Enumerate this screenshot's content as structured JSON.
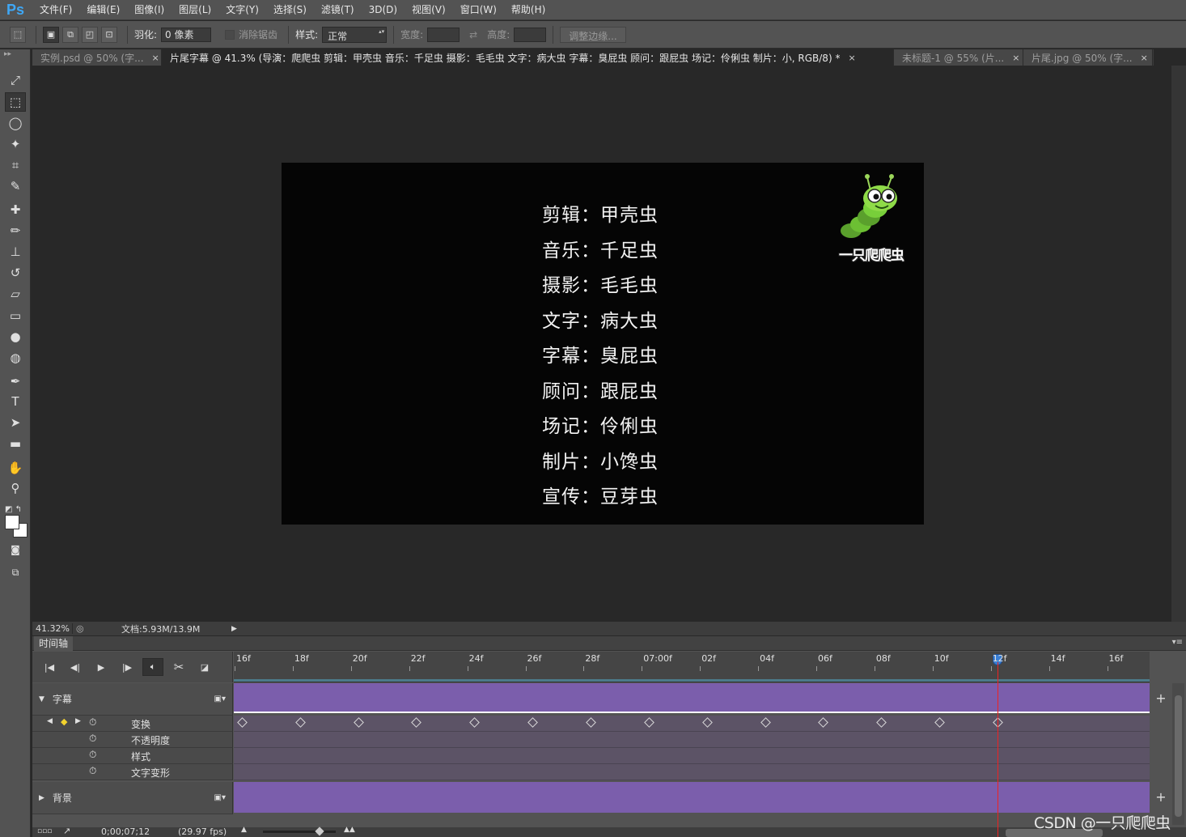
{
  "app": {
    "logo": "Ps"
  },
  "menu": [
    "文件(F)",
    "编辑(E)",
    "图像(I)",
    "图层(L)",
    "文字(Y)",
    "选择(S)",
    "滤镜(T)",
    "3D(D)",
    "视图(V)",
    "窗口(W)",
    "帮助(H)"
  ],
  "options": {
    "feather_label": "羽化:",
    "feather_value": "0 像素",
    "antialias_label": "消除锯齿",
    "style_label": "样式:",
    "style_value": "正常",
    "width_label": "宽度:",
    "height_label": "高度:",
    "refine_edge": "调整边缘..."
  },
  "tabs": [
    {
      "label": "实例.psd @ 50% (字...",
      "active": false
    },
    {
      "label": "片尾字幕 @ 41.3% (导演：爬爬虫   剪辑：甲壳虫 音乐：千足虫 摄影：毛毛虫 文字：病大虫 字幕：臭屁虫 顾问：跟屁虫 场记：伶俐虫 制片：小, RGB/8) *",
      "active": true
    },
    {
      "label": "未标题-1 @ 55% (片...",
      "active": false
    },
    {
      "label": "片尾.jpg @ 50% (字...",
      "active": false
    }
  ],
  "tools": [
    "move-icon",
    "marquee-icon",
    "lasso-icon",
    "magic-wand-icon",
    "crop-icon",
    "eyedropper-icon",
    "healing-brush-icon",
    "brush-icon",
    "stamp-icon",
    "history-brush-icon",
    "eraser-icon",
    "gradient-icon",
    "blur-icon",
    "dodge-icon",
    "pen-icon",
    "type-icon",
    "path-select-icon",
    "shape-icon",
    "hand-icon",
    "zoom-icon"
  ],
  "canvas": {
    "credits": [
      "剪辑：甲壳虫",
      "音乐：千足虫",
      "摄影：毛毛虫",
      "文字：病大虫",
      "字幕：臭屁虫",
      "顾问：跟屁虫",
      "场记：伶俐虫",
      "制片：小馋虫",
      "宣传：豆芽虫"
    ],
    "logo_text": "一只爬爬虫"
  },
  "status": {
    "zoom": "41.32%",
    "doc": "文档:5.93M/13.9M"
  },
  "timeline": {
    "title": "时间轴",
    "ruler_labels": [
      "16f",
      "18f",
      "20f",
      "22f",
      "24f",
      "26f",
      "28f",
      "07:00f",
      "02f",
      "04f",
      "06f",
      "08f",
      "10f",
      "12f",
      "14f",
      "16f"
    ],
    "layers": [
      {
        "name": "字幕",
        "expanded": true,
        "props": [
          "变换",
          "不透明度",
          "样式",
          "文字变形"
        ]
      },
      {
        "name": "背景",
        "expanded": false
      }
    ],
    "timecode": "0;00;07;12",
    "fps": "(29.97 fps)"
  },
  "watermark": "CSDN @一只爬爬虫",
  "colors": {
    "track": "#7b5eac",
    "playhead": "#ee2222",
    "ps_blue": "#3fa7f5"
  }
}
